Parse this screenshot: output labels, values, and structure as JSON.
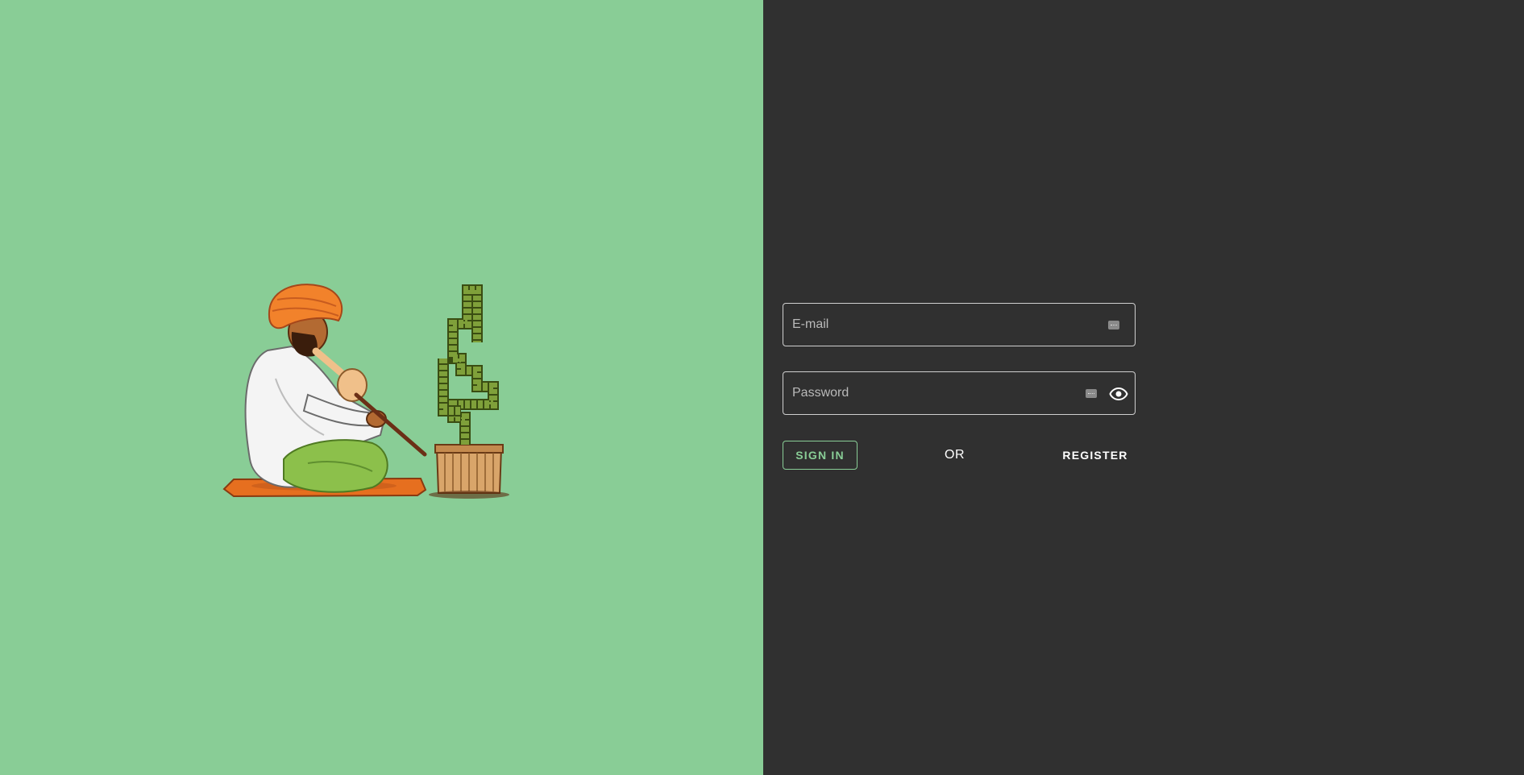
{
  "colors": {
    "left_background": "#89cd96",
    "right_background": "#303030",
    "accent": "#89cd96",
    "field_border": "#cfcfcf",
    "text_primary": "#ffffff"
  },
  "illustration": {
    "icon": "snake-charmer-illustration"
  },
  "login_form": {
    "email_placeholder": "E-mail",
    "password_placeholder": "Password",
    "signin_label": "SIGN IN",
    "or_label": "OR",
    "register_label": "REGISTER"
  },
  "icons": {
    "autofill": "autofill-key-icon",
    "password_visibility": "eye-icon"
  }
}
